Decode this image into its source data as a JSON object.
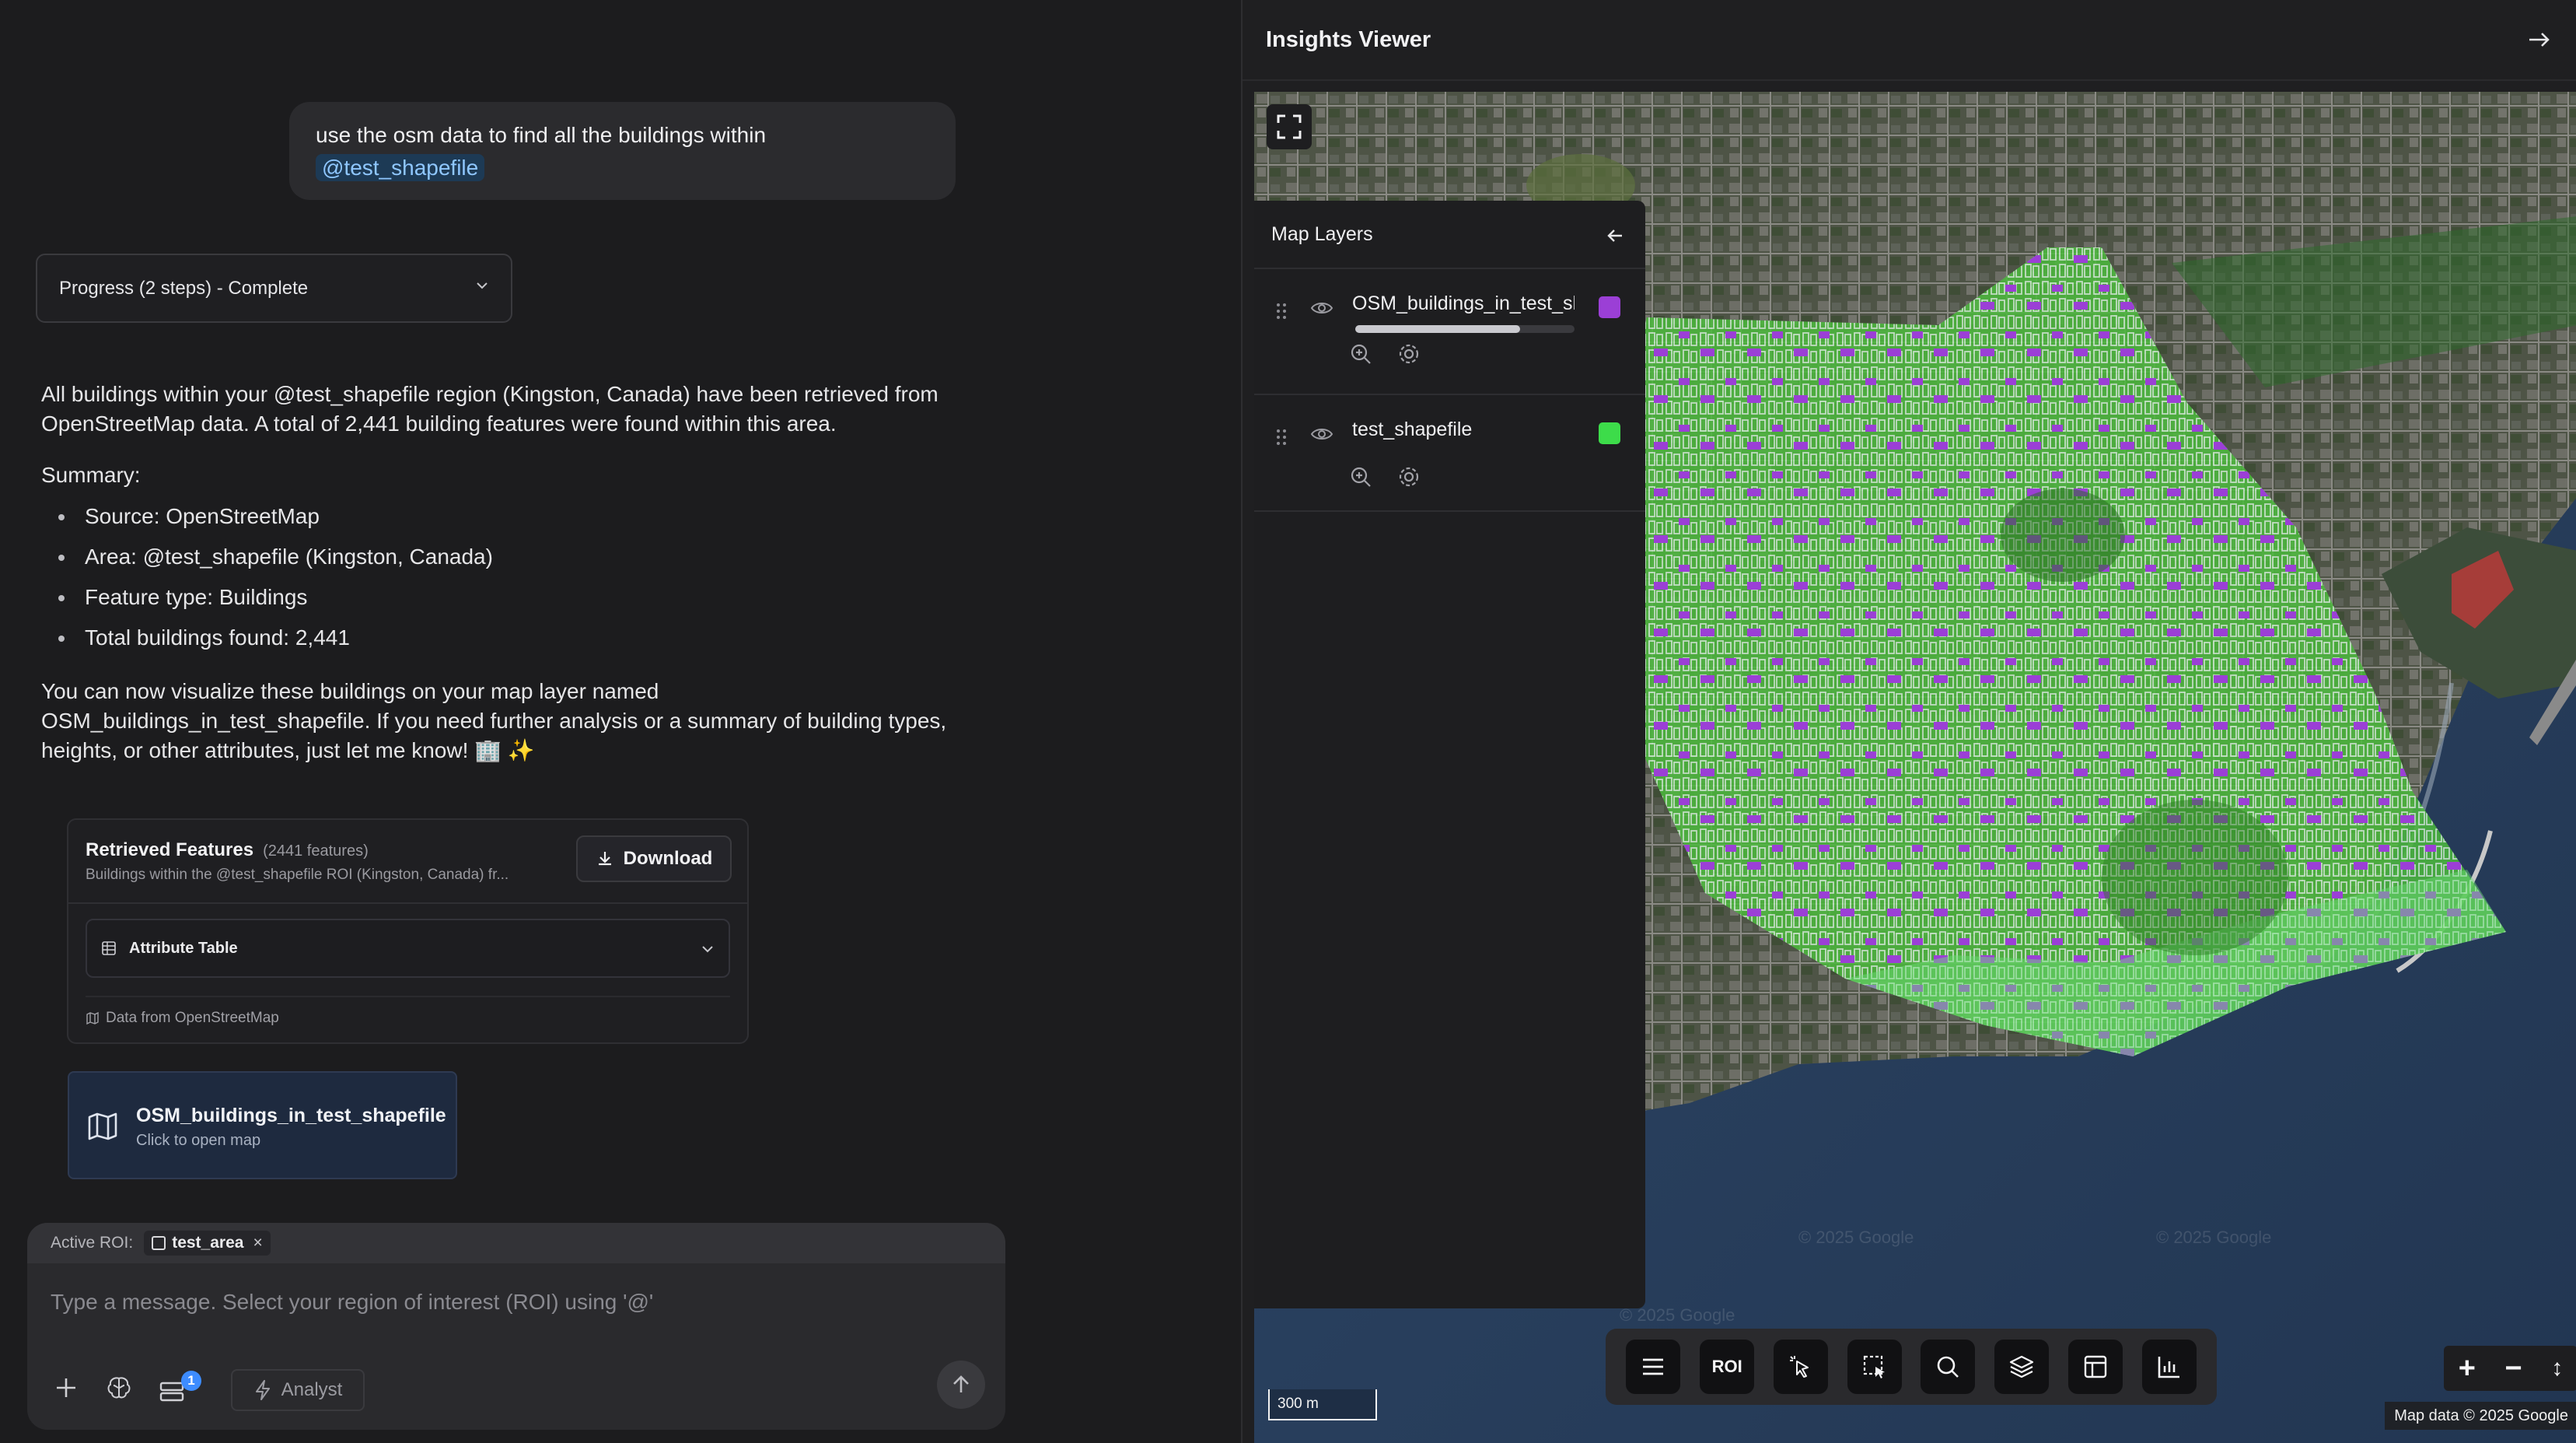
{
  "chat": {
    "user_message": {
      "text": "use the osm data to find all the buildings within",
      "mention": "@test_shapefile"
    },
    "progress": {
      "label": "Progress (2 steps) - Complete"
    },
    "answer": {
      "intro": "All buildings within your @test_shapefile region (Kingston, Canada) have been retrieved from OpenStreetMap data. A total of 2,441 building features were found within this area.",
      "summary_heading": "Summary:",
      "bullets": [
        "Source: OpenStreetMap",
        "Area: @test_shapefile (Kingston, Canada)",
        "Feature type: Buildings",
        "Total buildings found: 2,441"
      ],
      "closing": "You can now visualize these buildings on your map layer named OSM_buildings_in_test_shapefile. If you need further analysis or a summary of building types, heights, or other attributes, just let me know! 🏢 ✨"
    },
    "features_card": {
      "title": "Retrieved Features",
      "count": "(2441 features)",
      "description": "Buildings within the @test_shapefile ROI (Kingston, Canada) fr...",
      "download_label": "Download",
      "attribute_table_label": "Attribute Table",
      "source_label": "Data from OpenStreetMap"
    },
    "map_link": {
      "name": "OSM_buildings_in_test_shapefile",
      "subtitle": "Click to open map"
    },
    "composer": {
      "active_roi_label": "Active ROI:",
      "roi_chip": "test_area",
      "placeholder": "Type a message. Select your region of interest (ROI) using '@'",
      "badge_count": "1",
      "mode_label": "Analyst"
    }
  },
  "viewer": {
    "title": "Insights Viewer",
    "layers_panel": {
      "title": "Map Layers",
      "layers": [
        {
          "name": "OSM_buildings_in_test_shapefile",
          "color": "#9b3fd6",
          "opacity": 0.75
        },
        {
          "name": "test_shapefile",
          "color": "#3ddc4a"
        }
      ]
    },
    "toolbar": {
      "roi_label": "ROI",
      "tools": [
        "menu-icon",
        "roi",
        "pointer-icon",
        "select-box-icon",
        "search-icon",
        "layers-icon",
        "table-icon",
        "bar-chart-icon"
      ]
    },
    "zoom": {
      "in": "+",
      "out": "−",
      "compass": "↕"
    },
    "scale_label": "300 m",
    "attribution": "Map data © 2025 Google",
    "watermark": "© 2025 Google"
  },
  "colors": {
    "accent_blue": "#3d8cff",
    "roi_green": "#3ddc4a",
    "buildings_purple": "#9b3fd6"
  }
}
